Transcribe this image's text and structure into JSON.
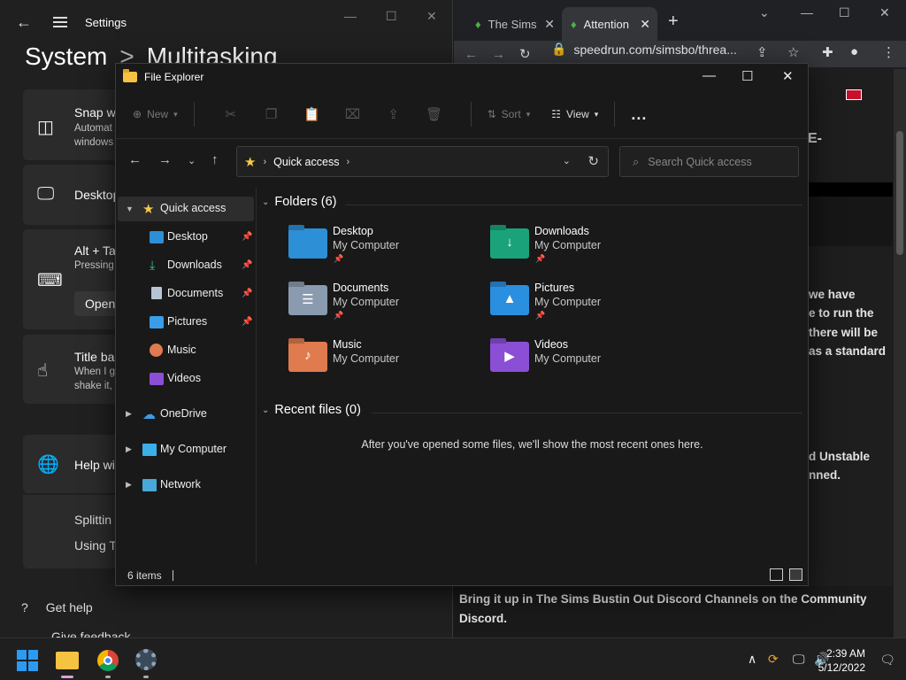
{
  "settings": {
    "window_title": "Settings",
    "breadcrumb_parent": "System",
    "breadcrumb_sep": ">",
    "breadcrumb_current": "Multitasking",
    "cards": [
      {
        "title": "Snap w",
        "desc1": "Automat",
        "desc2": "windows"
      },
      {
        "title": "Desktop"
      },
      {
        "title": "Alt + Ta",
        "desc1": "Pressing",
        "button": "Open"
      },
      {
        "title": "Title ba",
        "desc1": "When I g",
        "desc2": "shake it,"
      },
      {
        "title": "Help wi"
      }
    ],
    "help_links": [
      "Splittin",
      "Using T"
    ],
    "get_help": "Get help",
    "give_feedback": "Give feedback"
  },
  "chrome": {
    "tabs": [
      {
        "title": "The Sims"
      },
      {
        "title": "Attention"
      }
    ],
    "url": "speedrun.com/simsbo/threa...",
    "heading_fragment": "E-",
    "para1": [
      "we have",
      "e to run the",
      "there will be",
      "as a standard"
    ],
    "para2": [
      "d Unstable",
      "nned."
    ],
    "bottom_text": [
      "Bring it up in The Sims Bustin Out Discord Channels on the Community",
      "Discord."
    ]
  },
  "explorer": {
    "window_title": "File Explorer",
    "commands": {
      "new": "New",
      "sort": "Sort",
      "view": "View",
      "more": "..."
    },
    "address": {
      "location": "Quick access"
    },
    "search": {
      "placeholder": "Search Quick access"
    },
    "nav": [
      {
        "label": "Quick access",
        "icon": "star-icon"
      },
      {
        "label": "Desktop",
        "icon": "desktop-icon"
      },
      {
        "label": "Downloads",
        "icon": "download-icon"
      },
      {
        "label": "Documents",
        "icon": "documents-icon"
      },
      {
        "label": "Pictures",
        "icon": "pictures-icon"
      },
      {
        "label": "Music",
        "icon": "music-icon"
      },
      {
        "label": "Videos",
        "icon": "videos-icon"
      },
      {
        "label": "OneDrive",
        "icon": "cloud-icon"
      },
      {
        "label": "My Computer",
        "icon": "computer-icon"
      },
      {
        "label": "Network",
        "icon": "network-icon"
      }
    ],
    "folders_header": "Folders (6)",
    "folders": [
      {
        "name": "Desktop",
        "location": "My Computer",
        "color": "#2d8fd5",
        "symbol": ""
      },
      {
        "name": "Downloads",
        "location": "My Computer",
        "color": "#1aa37a",
        "symbol": "↓"
      },
      {
        "name": "Documents",
        "location": "My Computer",
        "color": "#8a9bb0",
        "symbol": "☰"
      },
      {
        "name": "Pictures",
        "location": "My Computer",
        "color": "#2b8fe0",
        "symbol": "▲"
      },
      {
        "name": "Music",
        "location": "My Computer",
        "color": "#e07a4f",
        "symbol": "♪"
      },
      {
        "name": "Videos",
        "location": "My Computer",
        "color": "#8b4fd6",
        "symbol": "▶"
      }
    ],
    "recent_header": "Recent files (0)",
    "recent_empty": "After you've opened some files, we'll show the most recent ones here.",
    "status_items": "6 items"
  },
  "taskbar": {
    "time": "2:39 AM",
    "date": "5/12/2022"
  }
}
